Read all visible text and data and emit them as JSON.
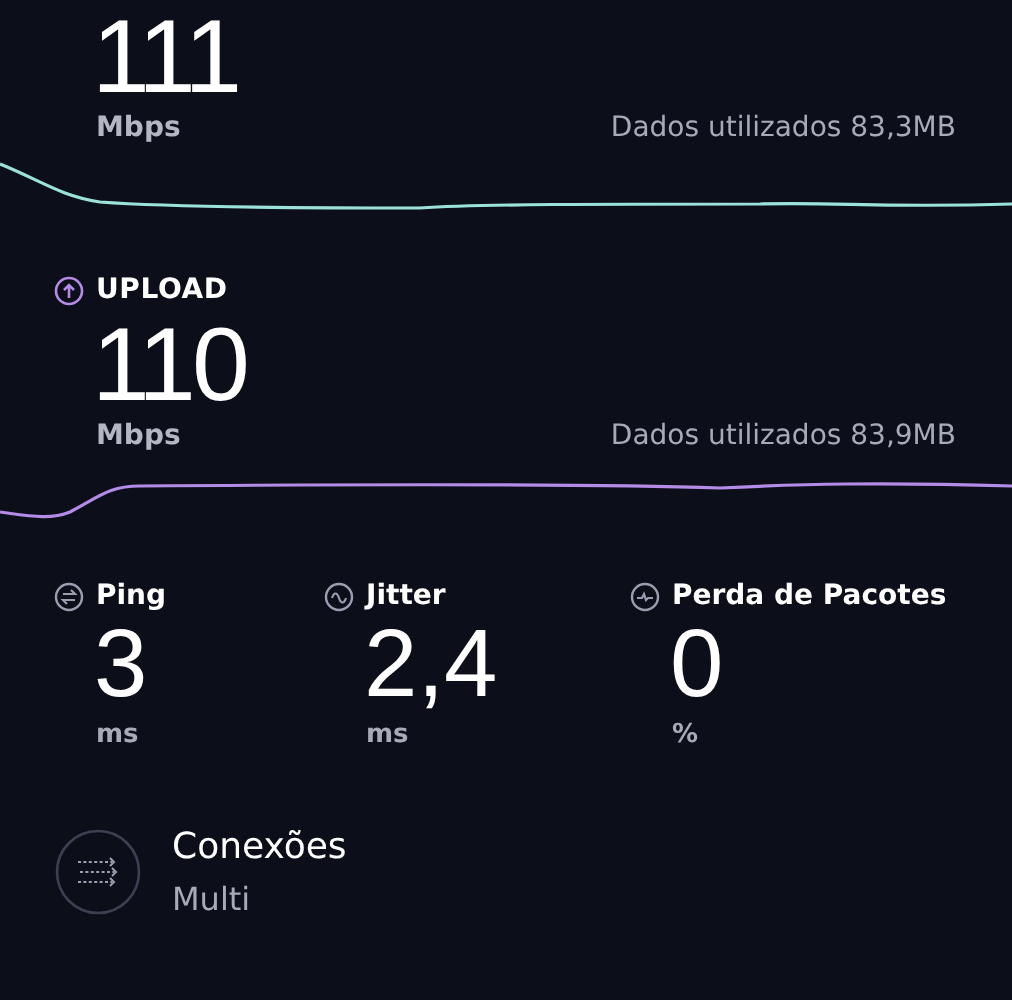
{
  "download": {
    "value": "111",
    "unit": "Mbps",
    "data_used": "Dados utilizados 83,3MB"
  },
  "upload": {
    "label": "UPLOAD",
    "value": "110",
    "unit": "Mbps",
    "data_used": "Dados utilizados 83,9MB"
  },
  "metrics": [
    {
      "kind": "ping",
      "label": "Ping",
      "value": "3",
      "unit": "ms"
    },
    {
      "kind": "jitter",
      "label": "Jitter",
      "value": "2,4",
      "unit": "ms"
    },
    {
      "kind": "loss",
      "label": "Perda de Pacotes",
      "value": "0",
      "unit": "%"
    }
  ],
  "connections": {
    "label": "Conexões",
    "value": "Multi"
  }
}
